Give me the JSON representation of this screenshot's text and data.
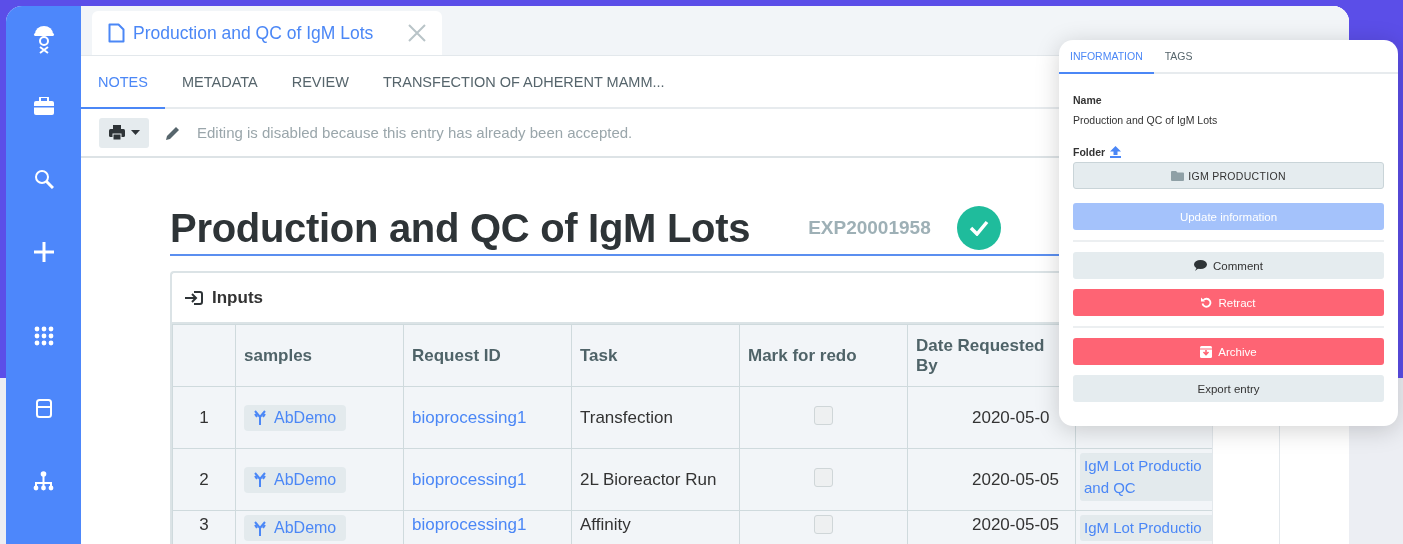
{
  "document_tab": {
    "title": "Production and QC of IgM Lots"
  },
  "subtabs": [
    {
      "label": "NOTES",
      "selected": true
    },
    {
      "label": "METADATA",
      "selected": false
    },
    {
      "label": "REVIEW",
      "selected": false
    },
    {
      "label": "TRANSFECTION OF ADHERENT MAMM...",
      "selected": false
    }
  ],
  "toolbar": {
    "notice": "Editing is disabled because this entry has already been accepted."
  },
  "entry": {
    "title": "Production and QC of IgM Lots",
    "id": "EXP20001958",
    "accepted": true
  },
  "inputs": {
    "title": "Inputs",
    "columns": [
      "samples",
      "Request ID",
      "Task",
      "Mark for redo",
      "Date Requested By"
    ],
    "rows": [
      {
        "number": "1",
        "sample": "AbDemo",
        "request_id": "bioprocessing1",
        "task": "Transfection",
        "mark_for_redo": false,
        "date": "2020-05-0"
      },
      {
        "number": "2",
        "sample": "AbDemo",
        "request_id": "bioprocessing1",
        "task": "2L Bioreactor Run",
        "mark_for_redo": false,
        "date": "2020-05-05",
        "column_7": "IgM Lot Productio and QC"
      },
      {
        "number": "3",
        "sample": "AbDemo",
        "request_id": "bioprocessing1",
        "task": "Affinity",
        "mark_for_redo": false,
        "date": "2020-05-05",
        "column_7": "IgM Lot Productio"
      }
    ]
  },
  "panel": {
    "tabs": [
      {
        "label": "INFORMATION",
        "selected": true
      },
      {
        "label": "TAGS",
        "selected": false
      }
    ],
    "name_label": "Name",
    "name": "Production and QC of IgM Lots",
    "folder_label": "Folder",
    "folder": "IGM PRODUCTION",
    "action_groups": [
      [
        {
          "label": "Update information",
          "kind": "primary",
          "disabled": true
        }
      ],
      [
        {
          "label": "Comment",
          "kind": "comment",
          "disabled": false
        },
        {
          "label": "Retract",
          "kind": "retract",
          "disabled": false
        }
      ],
      [
        {
          "label": "Archive",
          "kind": "archive",
          "disabled": false
        },
        {
          "label": "Export entry",
          "kind": "plain",
          "disabled": false
        }
      ]
    ]
  }
}
